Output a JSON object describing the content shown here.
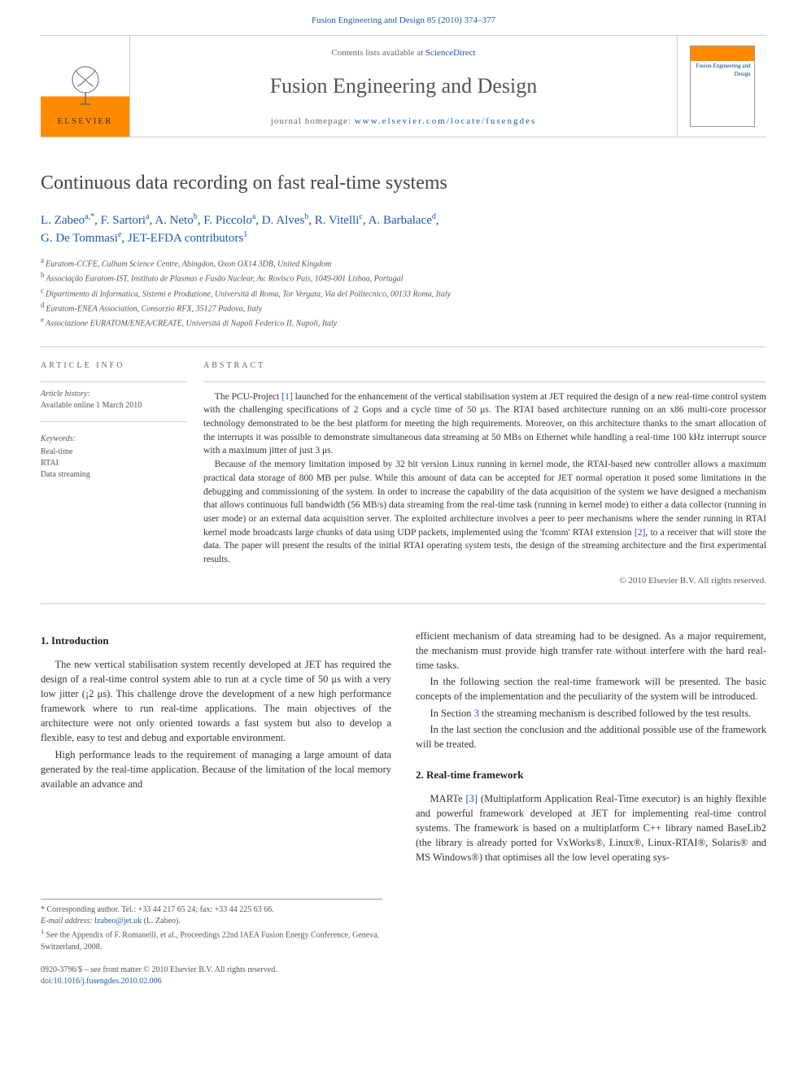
{
  "header": {
    "citation": "Fusion Engineering and Design 85 (2010) 374–377",
    "contents_prefix": "Contents lists available at ",
    "contents_link": "ScienceDirect",
    "journal_name": "Fusion Engineering and Design",
    "homepage_prefix": "journal homepage: ",
    "homepage_link": "www.elsevier.com/locate/fusengdes",
    "publisher_label": "ELSEVIER",
    "cover_label": "Fusion Engineering and Design"
  },
  "title": "Continuous data recording on fast real-time systems",
  "authors_line": "L. Zabeoa,*, F. Sartoria, A. Netob, F. Piccoloa, D. Alvesb, R. Vitellic, A. Barbalaced, G. De Tommasie, JET-EFDA contributors1",
  "affiliations": [
    {
      "sup": "a",
      "text": "Euratom-CCFE, Culham Science Centre, Abingdon, Oxon OX14 3DB, United Kingdom"
    },
    {
      "sup": "b",
      "text": "Associação Euratom-IST, Instituto de Plasmas e Fusão Nuclear, Av. Rovisco Pais, 1049-001 Lisboa, Portugal"
    },
    {
      "sup": "c",
      "text": "Dipartimento di Informatica, Sistemi e Produzione, Universitá di Roma, Tor Vergata, Via del Politecnico, 00133 Roma, Italy"
    },
    {
      "sup": "d",
      "text": "Euratom-ENEA Association, Consorzio RFX, 35127 Padova, Italy"
    },
    {
      "sup": "e",
      "text": "Associazione EURATOM/ENEA/CREATE, Universitá di Napoli Federico II, Napoli, Italy"
    }
  ],
  "article_info": {
    "head": "ARTICLE INFO",
    "history_label": "Article history:",
    "history": "Available online 1 March 2010",
    "keywords_label": "Keywords:",
    "keywords": [
      "Real-time",
      "RTAI",
      "Data streaming"
    ]
  },
  "abstract": {
    "head": "ABSTRACT",
    "p1": "The PCU-Project [1] launched for the enhancement of the vertical stabilisation system at JET required the design of a new real-time control system with the challenging specifications of 2 Gops and a cycle time of 50 μs. The RTAI based architecture running on an x86 multi-core processor technology demonstrated to be the best platform for meeting the high requirements. Moreover, on this architecture thanks to the smart allocation of the interrupts it was possible to demonstrate simultaneous data streaming at 50 MBs on Ethernet while handling a real-time 100 kHz interrupt source with a maximum jitter of just 3 μs.",
    "p2": "Because of the memory limitation imposed by 32 bit version Linux running in kernel mode, the RTAI-based new controller allows a maximum practical data storage of 800 MB per pulse. While this amount of data can be accepted for JET normal operation it posed some limitations in the debugging and commissioning of the system. In order to increase the capability of the data acquisition of the system we have designed a mechanism that allows continuous full bandwidth (56 MB/s) data streaming from the real-time task (running in kernel mode) to either a data collector (running in user mode) or an external data acquisition server. The exploited architecture involves a peer to peer mechanisms where the sender running in RTAI kernel mode broadcasts large chunks of data using UDP packets, implemented using the 'fcomm' RTAI extension [2], to a receiver that will store the data. The paper will present the results of the initial RTAI operating system tests, the design of the streaming architecture and the first experimental results.",
    "ref1": "[1]",
    "ref2": "[2]",
    "copyright": "© 2010 Elsevier B.V. All rights reserved."
  },
  "sections": {
    "s1": {
      "heading": "1. Introduction",
      "p1": "The new vertical stabilisation system recently developed at JET has required the design of a real-time control system able to run at a cycle time of 50 μs with a very low jitter (¡2 μs). This challenge drove the development of a new high performance framework where to run real-time applications. The main objectives of the architecture were not only oriented towards a fast system but also to develop a flexible, easy to test and debug and exportable environment.",
      "p2": "High performance leads to the requirement of managing a large amount of data generated by the real-time application. Because of the limitation of the local memory available an advance and",
      "p3": "efficient mechanism of data streaming had to be designed. As a major requirement, the mechanism must provide high transfer rate without interfere with the hard real-time tasks.",
      "p4": "In the following section the real-time framework will be presented. The basic concepts of the implementation and the peculiarity of the system will be introduced.",
      "p5_a": "In Section ",
      "p5_link": "3",
      "p5_b": " the streaming mechanism is described followed by the test results.",
      "p6": "In the last section the conclusion and the additional possible use of the framework will be treated."
    },
    "s2": {
      "heading": "2. Real-time framework",
      "p1_a": "MARTe ",
      "p1_link": "[3]",
      "p1_b": " (Multiplatform Application Real-Time executor) is an highly flexible and powerful framework developed at JET for implementing real-time control systems. The framework is based on a multiplatform C++ library named BaseLib2 (the library is already ported for VxWorks®, Linux®, Linux-RTAI®, Solaris® and MS Windows®) that optimises all the low level operating sys-"
    }
  },
  "footnotes": {
    "corr_label": "* Corresponding author. Tel.: +33 44 217 65 24; fax: +33 44 225 63 66.",
    "email_label": "E-mail address: ",
    "email": "lzabeo@jet.uk",
    "email_suffix": " (L. Zabeo).",
    "note1_sup": "1",
    "note1": " See the Appendix of F. Romanelli, et al., Proceedings 22nd IAEA Fusion Energy Conference, Geneva, Switzerland, 2008."
  },
  "bottom": {
    "issn": "0920-3796/$ – see front matter © 2010 Elsevier B.V. All rights reserved.",
    "doi_label": "doi:",
    "doi": "10.1016/j.fusengdes.2010.02.006"
  }
}
